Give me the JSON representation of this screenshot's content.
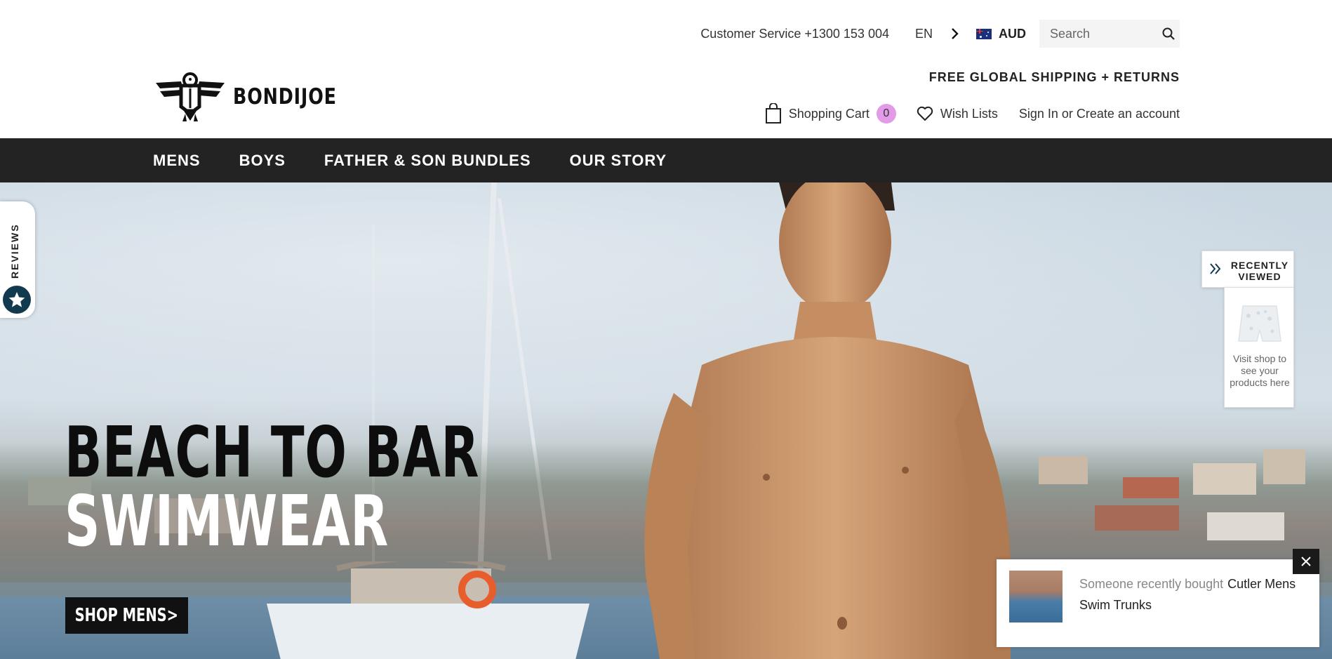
{
  "header": {
    "customer_service": "Customer Service +1300 153 004",
    "language": "EN",
    "currency": "AUD",
    "search_placeholder": "Search",
    "shipping_banner": "FREE GLOBAL SHIPPING + RETURNS",
    "logo_text": "BONDIJOE",
    "cart_label": "Shopping Cart",
    "cart_count": "0",
    "wishlist_label": "Wish Lists",
    "sign_in_text": "Sign In or Create an account",
    "cart_badge_color": "#e29be6"
  },
  "nav": {
    "items": [
      "MENS",
      "BOYS",
      "FATHER & SON BUNDLES",
      "OUR STORY"
    ],
    "background": "#232323"
  },
  "hero": {
    "headline_line1": "BEACH TO BAR",
    "headline_line2": "SWIMWEAR",
    "cta_label": "SHOP MENS>"
  },
  "reviews_tab": {
    "label": "REVIEWS",
    "icon": "star-icon"
  },
  "recently_viewed": {
    "title": "RECENTLY VIEWED",
    "empty_text": "Visit shop to see your products here"
  },
  "purchase_popup": {
    "prefix": "Someone recently bought",
    "product": "Cutler Mens Swim Trunks"
  }
}
